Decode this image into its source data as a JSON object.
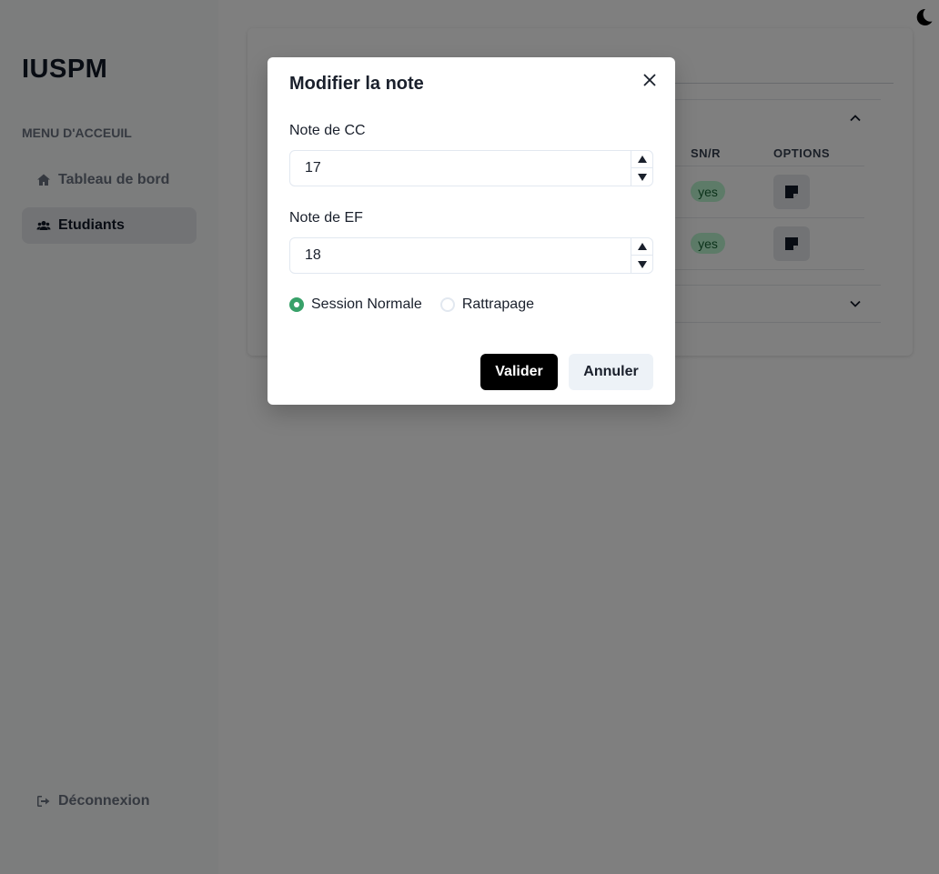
{
  "app": {
    "brand": "IUSPM",
    "menu_title": "MENU D'ACCEUIL",
    "nav": [
      {
        "label": "Tableau de bord",
        "icon": "home-icon",
        "active": false
      },
      {
        "label": "Etudiants",
        "icon": "users-icon",
        "active": true
      }
    ],
    "logout_label": "Déconnexion",
    "theme_icon": "moon-icon"
  },
  "background_table": {
    "headers": [
      "SN/R",
      "OPTIONS"
    ],
    "rows": [
      {
        "snr": "yes",
        "option_icon": "note-icon"
      },
      {
        "snr": "yes",
        "option_icon": "note-icon"
      }
    ]
  },
  "modal": {
    "title": "Modifier la note",
    "cc_label": "Note de CC",
    "cc_value": "17",
    "ef_label": "Note de EF",
    "ef_value": "18",
    "radios": [
      {
        "label": "Session Normale",
        "checked": true
      },
      {
        "label": "Rattrapage",
        "checked": false
      }
    ],
    "submit_label": "Valider",
    "cancel_label": "Annuler"
  },
  "colors": {
    "accent_green": "#38a169",
    "primary_button": "#000000",
    "badge_bg": "#bbf7d0"
  }
}
